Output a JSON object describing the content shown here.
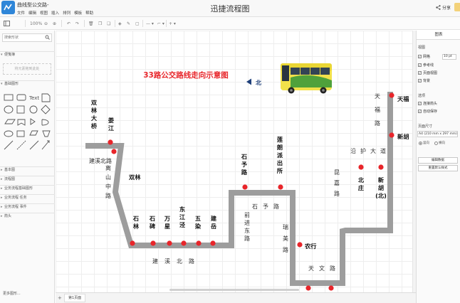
{
  "titlebar": {
    "doc_title": "曲线型公交路-",
    "menu": [
      "文件",
      "编辑",
      "视图",
      "插入",
      "排列",
      "模板",
      "帮助"
    ],
    "app_title": "迅捷流程图",
    "share_label": "分享"
  },
  "toolbar": {
    "zoom_value": "100%",
    "icons": [
      "panel-icon",
      "zoom-out-icon",
      "zoom-in-icon",
      "undo-icon",
      "redo-icon",
      "delete-icon",
      "to-front-icon",
      "to-back-icon",
      "fill-icon",
      "line-color-icon",
      "shadow-icon",
      "connector-icon",
      "waypoint-icon",
      "insert-icon"
    ]
  },
  "sidebar": {
    "search_placeholder": "搜索形状",
    "sections": [
      "便笺簿",
      "基础图形",
      "基本图",
      "流程图",
      "业务流程基础图形",
      "业务流程 任务",
      "业务流程 事件",
      "箭头"
    ],
    "scratch_hint": "将元素拖到此处",
    "more_shapes": "更多图形..."
  },
  "panel": {
    "tab_label": "图表",
    "view_title": "视图",
    "view_options": [
      {
        "label": "网格",
        "checked": true
      },
      {
        "label": "参考线",
        "checked": true
      },
      {
        "label": "页面视图",
        "checked": true
      },
      {
        "label": "背景",
        "checked": true
      }
    ],
    "grid_size": "10 pt",
    "options_title": "选项",
    "options": [
      {
        "label": "连接箭头",
        "checked": true
      },
      {
        "label": "自动保存",
        "checked": true
      }
    ],
    "paper_title": "页面尺寸",
    "paper_size": "A4 (210 mm x 297 mm)",
    "orientation": [
      {
        "label": "竖向",
        "selected": true
      },
      {
        "label": "横向",
        "selected": false
      }
    ],
    "edit_data_button": "编辑数据",
    "reset_style_button": "重置默认样式"
  },
  "pagebar": {
    "add_label": "+",
    "page_tab": "第1页面"
  },
  "diagram": {
    "title": "33路公交路线走向示意图",
    "north_label": "北",
    "colors": {
      "title_red": "#e8262b",
      "route_gray": "#9d9d9d",
      "stop_red": "#e8252a",
      "north_arrow": "#1e3f7a"
    },
    "stations": [
      {
        "name": "双林大桥",
        "type": "stop-label"
      },
      {
        "name": "娄江",
        "type": "stop-label"
      },
      {
        "name": "双林",
        "type": "stop-label"
      },
      {
        "name": "石林",
        "type": "stop-label"
      },
      {
        "name": "石碑",
        "type": "stop-label"
      },
      {
        "name": "万星",
        "type": "stop-label"
      },
      {
        "name": "东江泾",
        "type": "stop-label"
      },
      {
        "name": "五染",
        "type": "stop-label"
      },
      {
        "name": "建岳",
        "type": "stop-label"
      },
      {
        "name": "石予路",
        "type": "stop-label"
      },
      {
        "name": "莲朗派出所",
        "type": "stop-label"
      },
      {
        "name": "农行",
        "type": "stop-label"
      },
      {
        "name": "北庄",
        "type": "stop-label"
      },
      {
        "name": "新胡(北)",
        "type": "stop-label"
      },
      {
        "name": "新胡",
        "type": "stop-label"
      },
      {
        "name": "天福",
        "type": "stop-label"
      }
    ],
    "road_labels": [
      "建溪北路",
      "离山中路",
      "建溪北路",
      "前进东路",
      "石予路",
      "瑞美路",
      "天文路",
      "昆嘉路",
      "沿护大道",
      "天福路"
    ]
  }
}
